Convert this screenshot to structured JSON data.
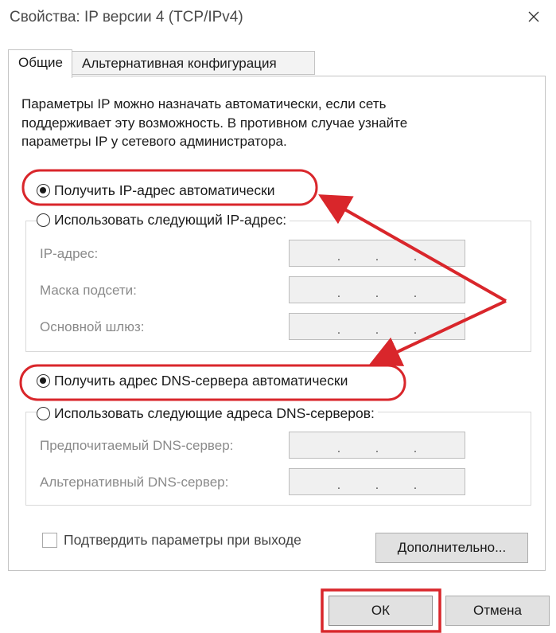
{
  "window": {
    "title": "Свойства: IP версии 4 (TCP/IPv4)",
    "close_icon": "close-icon"
  },
  "tabs": [
    {
      "label": "Общие",
      "active": true
    },
    {
      "label": "Альтернативная конфигурация",
      "active": false
    }
  ],
  "description": [
    "Параметры IP можно назначать автоматически, если сеть",
    "поддерживает эту возможность. В противном случае узнайте",
    "параметры IP у сетевого администратора."
  ],
  "ip_section": {
    "auto_label": "Получить IP-адрес автоматически",
    "auto_checked": true,
    "manual_label": "Использовать следующий IP-адрес:",
    "manual_checked": false,
    "fields": [
      {
        "label": "IP-адрес:",
        "value": ". . ."
      },
      {
        "label": "Маска подсети:",
        "value": ". . ."
      },
      {
        "label": "Основной шлюз:",
        "value": ". . ."
      }
    ]
  },
  "dns_section": {
    "auto_label": "Получить адрес DNS-сервера автоматически",
    "auto_checked": true,
    "manual_label": "Использовать следующие адреса DNS-серверов:",
    "manual_checked": false,
    "fields": [
      {
        "label": "Предпочитаемый DNS-сервер:",
        "value": ". . ."
      },
      {
        "label": "Альтернативный DNS-сервер:",
        "value": ". . ."
      }
    ]
  },
  "validate_checkbox": {
    "label": "Подтвердить параметры при выходе",
    "checked": false
  },
  "buttons": {
    "advanced": "Дополнительно...",
    "ok": "ОК",
    "cancel": "Отмена"
  },
  "annotation_color": "#d9262b"
}
